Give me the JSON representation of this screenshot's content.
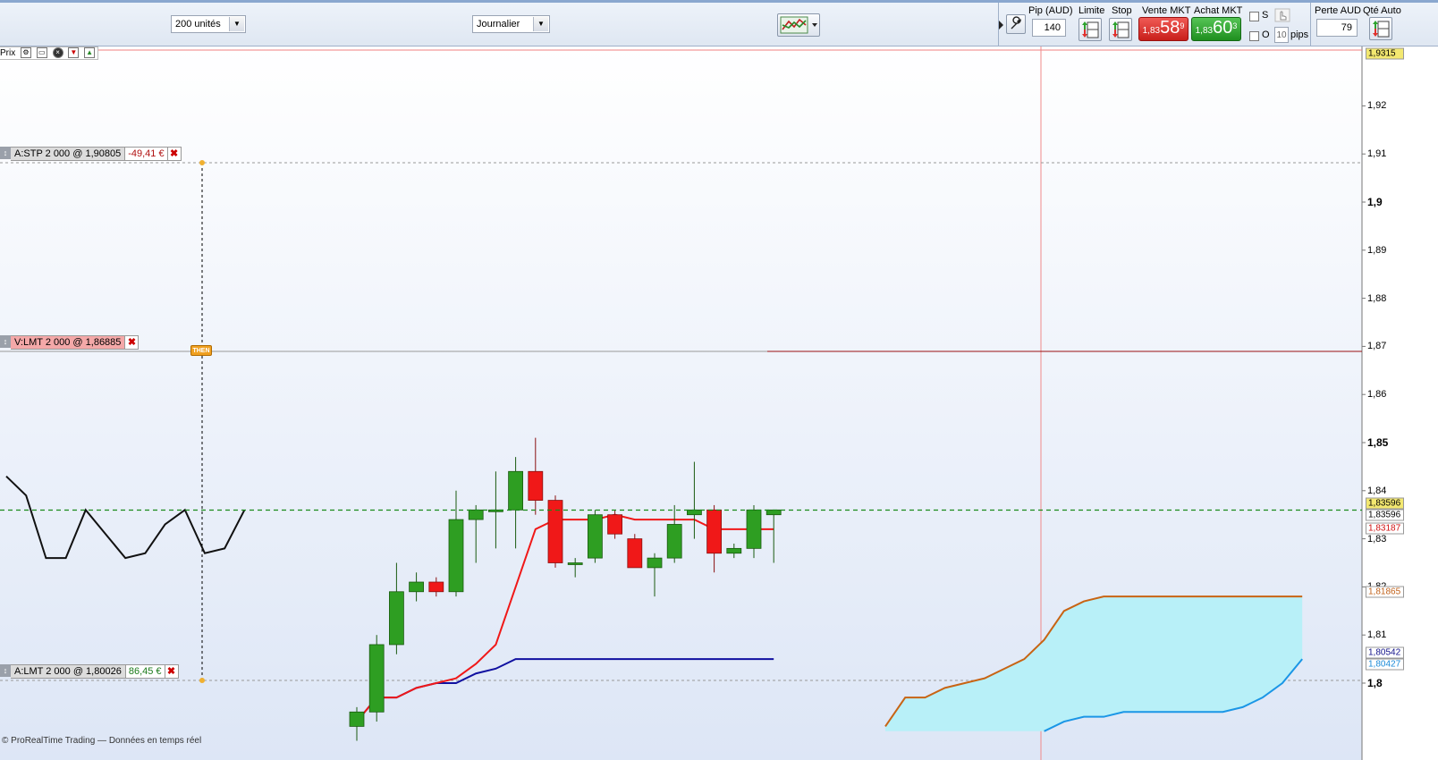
{
  "toolbar": {
    "quantity_select": "200 unités",
    "period_select": "Journalier",
    "pip_label": "Pip (AUD)",
    "pip_value": "140",
    "limit_label": "Limite",
    "stop_label": "Stop",
    "sell_label": "Vente MKT",
    "buy_label": "Achat MKT",
    "sell_price_small": "1,83",
    "sell_price_big": "58",
    "sell_price_sup": "9",
    "buy_price_small": "1,83",
    "buy_price_big": "60",
    "buy_price_sup": "3",
    "s_label": "S",
    "o_label": "O",
    "pips_value": "10",
    "pips_label": "pips",
    "loss_label": "Perte AUD",
    "loss_value": "79",
    "qty_auto_label": "Qté Auto",
    "colors": {
      "sell": "#e0302c",
      "buy": "#2ea32e"
    }
  },
  "chart": {
    "prix_label": "Prix",
    "footnote": "© ProRealTime Trading — Données en temps réel",
    "orders": [
      {
        "text": "A:STP  2 000 @ 1,90805",
        "pnl": "-49,41 €",
        "color": "#dcdcdc"
      },
      {
        "text": "V:LMT  2 000 @ 1,86885",
        "pnl": "",
        "color": "#f4a8a8"
      },
      {
        "text": "A:LMT  2 000 @ 1,80026",
        "pnl": "86,45 €",
        "color": "#dcdcdc"
      }
    ],
    "then_badge": "THEN",
    "price_tags": {
      "top": "1,9315",
      "current": "1,83596",
      "current2": "1,83596",
      "tenkan": "1,83187",
      "senkou_b": "1,81865",
      "kijun": "1,80542",
      "senkou_a": "1,80427"
    }
  },
  "chart_data": {
    "type": "candlestick",
    "y_ticks": [
      "1,92",
      "1,91",
      "1,9",
      "1,89",
      "1,88",
      "1,87",
      "1,86",
      "1,85",
      "1,84",
      "1,83",
      "1,82",
      "1,81",
      "1,8"
    ],
    "ylim": [
      1.792,
      1.933
    ],
    "current_price": 1.83596,
    "candles": [
      {
        "o": 1.791,
        "h": 1.795,
        "l": 1.788,
        "c": 1.794
      },
      {
        "o": 1.794,
        "h": 1.81,
        "l": 1.792,
        "c": 1.808
      },
      {
        "o": 1.808,
        "h": 1.825,
        "l": 1.806,
        "c": 1.819
      },
      {
        "o": 1.819,
        "h": 1.823,
        "l": 1.817,
        "c": 1.821
      },
      {
        "o": 1.821,
        "h": 1.822,
        "l": 1.818,
        "c": 1.819
      },
      {
        "o": 1.819,
        "h": 1.84,
        "l": 1.818,
        "c": 1.834
      },
      {
        "o": 1.834,
        "h": 1.837,
        "l": 1.825,
        "c": 1.836
      },
      {
        "o": 1.836,
        "h": 1.844,
        "l": 1.828,
        "c": 1.836
      },
      {
        "o": 1.836,
        "h": 1.847,
        "l": 1.828,
        "c": 1.844
      },
      {
        "o": 1.844,
        "h": 1.851,
        "l": 1.835,
        "c": 1.838
      },
      {
        "o": 1.838,
        "h": 1.839,
        "l": 1.824,
        "c": 1.825
      },
      {
        "o": 1.825,
        "h": 1.826,
        "l": 1.822,
        "c": 1.825
      },
      {
        "o": 1.826,
        "h": 1.836,
        "l": 1.825,
        "c": 1.835
      },
      {
        "o": 1.835,
        "h": 1.836,
        "l": 1.83,
        "c": 1.831
      },
      {
        "o": 1.83,
        "h": 1.831,
        "l": 1.824,
        "c": 1.824
      },
      {
        "o": 1.824,
        "h": 1.827,
        "l": 1.818,
        "c": 1.826
      },
      {
        "o": 1.826,
        "h": 1.837,
        "l": 1.825,
        "c": 1.833
      },
      {
        "o": 1.835,
        "h": 1.846,
        "l": 1.83,
        "c": 1.836
      },
      {
        "o": 1.836,
        "h": 1.837,
        "l": 1.823,
        "c": 1.827
      },
      {
        "o": 1.827,
        "h": 1.829,
        "l": 1.826,
        "c": 1.828
      },
      {
        "o": 1.828,
        "h": 1.837,
        "l": 1.826,
        "c": 1.836
      },
      {
        "o": 1.835,
        "h": 1.836,
        "l": 1.825,
        "c": 1.836
      }
    ],
    "price_line_left": [
      1.843,
      1.839,
      1.826,
      1.826,
      1.836,
      1.831,
      1.826,
      1.827,
      1.833,
      1.836,
      1.827,
      1.828,
      1.836
    ],
    "tenkan": [
      1.792,
      1.797,
      1.797,
      1.799,
      1.8,
      1.801,
      1.804,
      1.808,
      1.82,
      1.832,
      1.834,
      1.834,
      1.834,
      1.835,
      1.834,
      1.834,
      1.834,
      1.834,
      1.832,
      1.832,
      1.832,
      1.832
    ],
    "kijun": [
      1.792,
      1.797,
      1.797,
      1.799,
      1.8,
      1.8,
      1.802,
      1.803,
      1.805,
      1.805,
      1.805,
      1.805,
      1.805,
      1.805,
      1.805,
      1.805,
      1.805,
      1.805,
      1.805,
      1.805,
      1.805,
      1.805
    ],
    "senkou_b": [
      1.791,
      1.797,
      1.797,
      1.799,
      1.8,
      1.801,
      1.803,
      1.805,
      1.809,
      1.815,
      1.817,
      1.818,
      1.818,
      1.818,
      1.818,
      1.818,
      1.818,
      1.818,
      1.818,
      1.818,
      1.818,
      1.818
    ],
    "senkou_a": [
      1.79,
      1.792,
      1.793,
      1.793,
      1.794,
      1.794,
      1.794,
      1.794,
      1.794,
      1.794,
      1.795,
      1.797,
      1.8,
      1.805
    ]
  }
}
